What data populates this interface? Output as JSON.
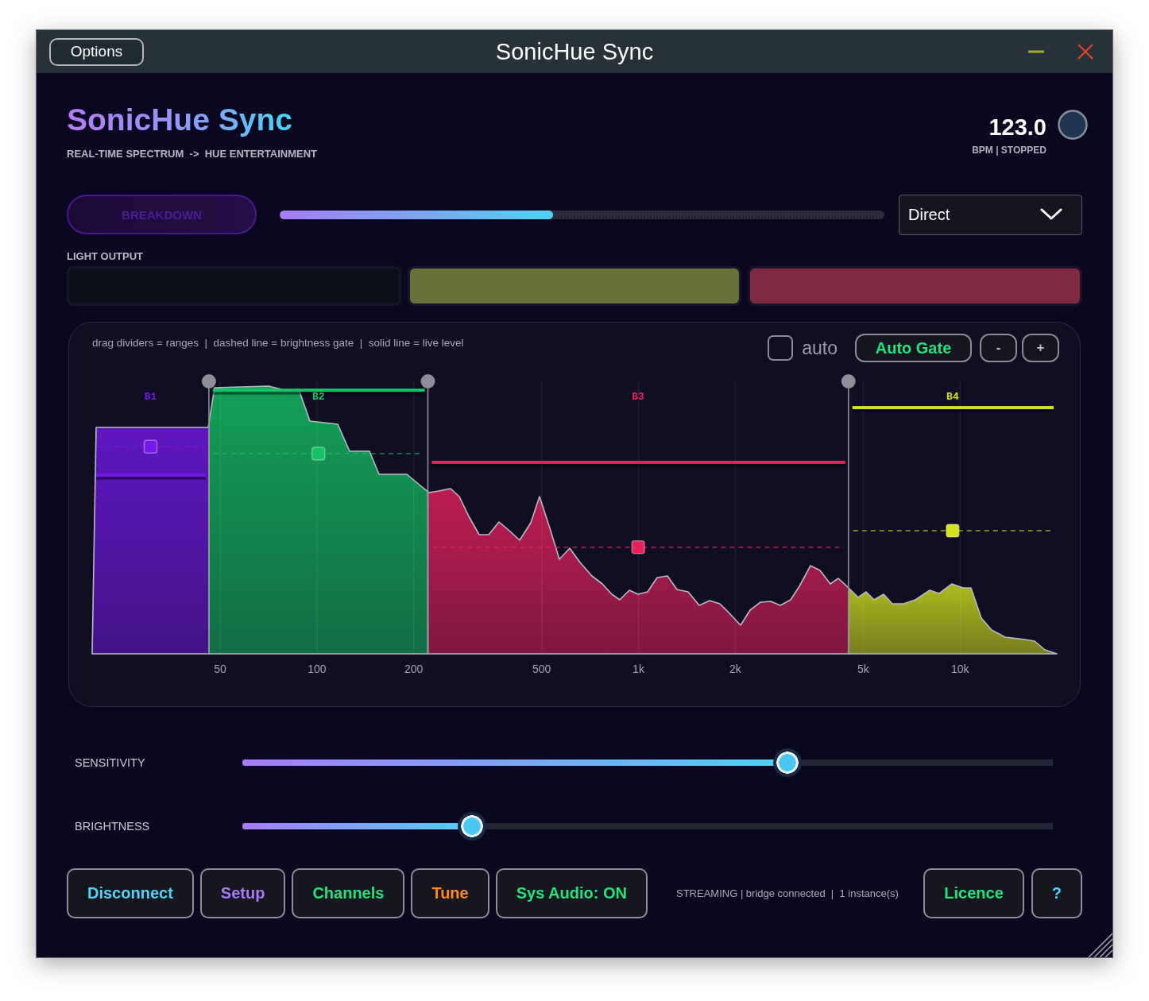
{
  "window": {
    "title": "SonicHue Sync",
    "menu_button": "Options"
  },
  "header": {
    "app_name": "SonicHue Sync",
    "subtitle": "REAL-TIME SPECTRUM  ->  HUE ENTERTAINMENT",
    "bpm": "123.0",
    "bpm_status": "BPM | STOPPED"
  },
  "mode_row": {
    "breakdown": {
      "label": "BREAKDOWN",
      "on": false
    },
    "progress": {
      "level": 0.452
    },
    "mode_select": {
      "value": "Direct"
    }
  },
  "light_output": {
    "label": "LIGHT OUTPUT",
    "lights": [
      {
        "color": "#0d0f18"
      },
      {
        "color": "#687137"
      },
      {
        "color": "#7e2a42"
      }
    ]
  },
  "spectrum": {
    "legend": "drag dividers = ranges  |  dashed line = brightness gate  |  solid line = live level",
    "auto": {
      "label": "auto",
      "checked": false
    },
    "auto_gate_button": "Auto Gate",
    "minus_button": "-",
    "plus_button": "+",
    "dividers": [
      {
        "level": 0.121
      },
      {
        "level": 0.348
      },
      {
        "level": 0.784
      }
    ],
    "bands": [
      {
        "label": "B1",
        "color": "#7318e6"
      },
      {
        "label": "B2",
        "color": "#14c464"
      },
      {
        "label": "B3",
        "color": "#e8205e"
      },
      {
        "label": "B4",
        "color": "#d4e41c"
      }
    ],
    "freq_labels": [
      "50",
      "100",
      "200",
      "500",
      "1k",
      "2k",
      "5k",
      "10k"
    ]
  },
  "sliders": [
    {
      "label": "SENSITIVITY",
      "level": 0.673
    },
    {
      "label": "BRIGHTNESS",
      "level": 0.283
    }
  ],
  "footer": {
    "buttons": [
      {
        "label": "Disconnect",
        "color": "#52d3f5"
      },
      {
        "label": "Setup",
        "color": "#a77cf6"
      },
      {
        "label": "Channels",
        "color": "#22e27e"
      },
      {
        "label": "Tune",
        "color": "#ff8c1a"
      },
      {
        "label": "Sys Audio: ON",
        "color": "#22e27e"
      }
    ],
    "status": "STREAMING | bridge connected  |  1 instance(s)",
    "right_buttons": [
      {
        "label": "Licence",
        "color": "#22e27e"
      },
      {
        "label": "?",
        "color": "#52d3f5"
      }
    ]
  }
}
